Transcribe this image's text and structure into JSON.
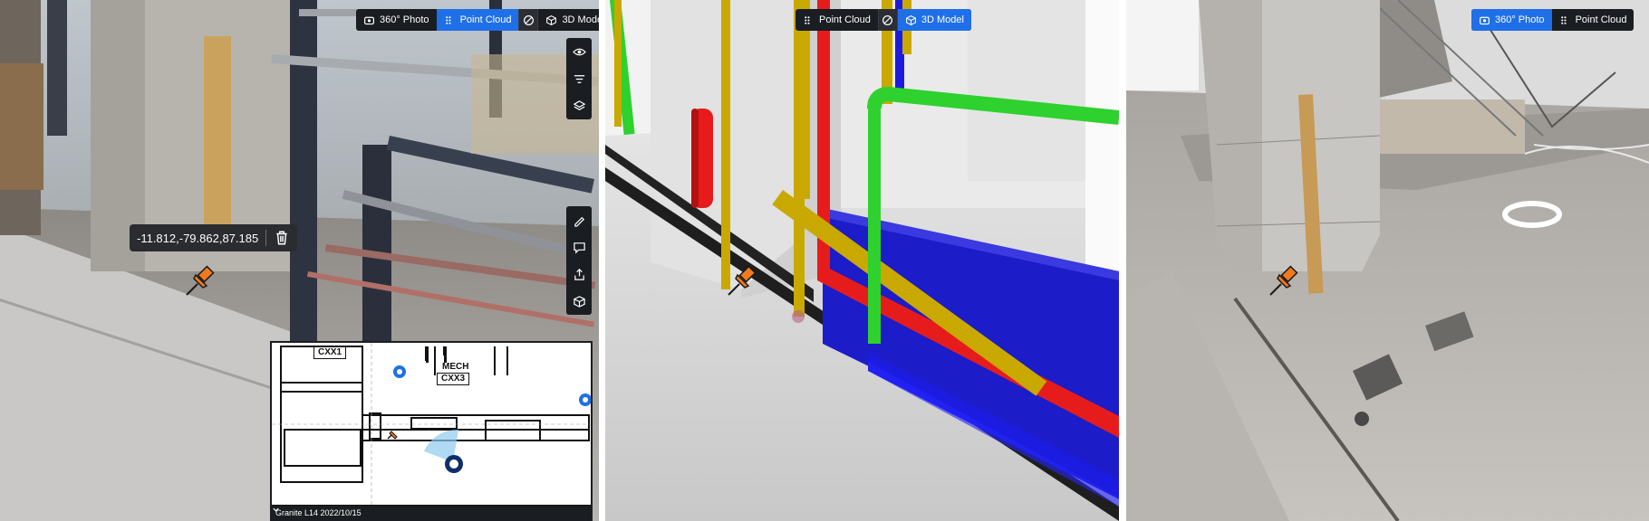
{
  "toolbar": {
    "photo_label": "360° Photo",
    "pointcloud_label": "Point Cloud",
    "model_label": "3D Model"
  },
  "measurement": {
    "coordinates": "-11.812,-79.862,87.185"
  },
  "minimap": {
    "rooms": [
      "CXX1",
      "MECH",
      "CXX3"
    ],
    "caption": "Granite L14 2022/10/15"
  },
  "colors": {
    "accent": "#1f6fe8",
    "toolbar_bg": "#1a1d21",
    "pin": "#f07a1d",
    "pipe_green": "#2ed12e",
    "pipe_red": "#e61c1c",
    "pipe_blue": "#1c1ce0",
    "pipe_yellow": "#c9a800"
  },
  "icons": {
    "photo": "photo-360-icon",
    "pointcloud": "grid-dots-icon",
    "sync": "sync-compare-icon",
    "model": "cube-icon",
    "visibility": "eye-icon",
    "filter": "filter-icon",
    "layers": "layers-icon",
    "measure": "ruler-pencil-icon",
    "comment": "comment-icon",
    "share": "share-icon",
    "box": "box-3d-icon",
    "delete": "trash-icon",
    "pin": "pushpin-icon"
  }
}
